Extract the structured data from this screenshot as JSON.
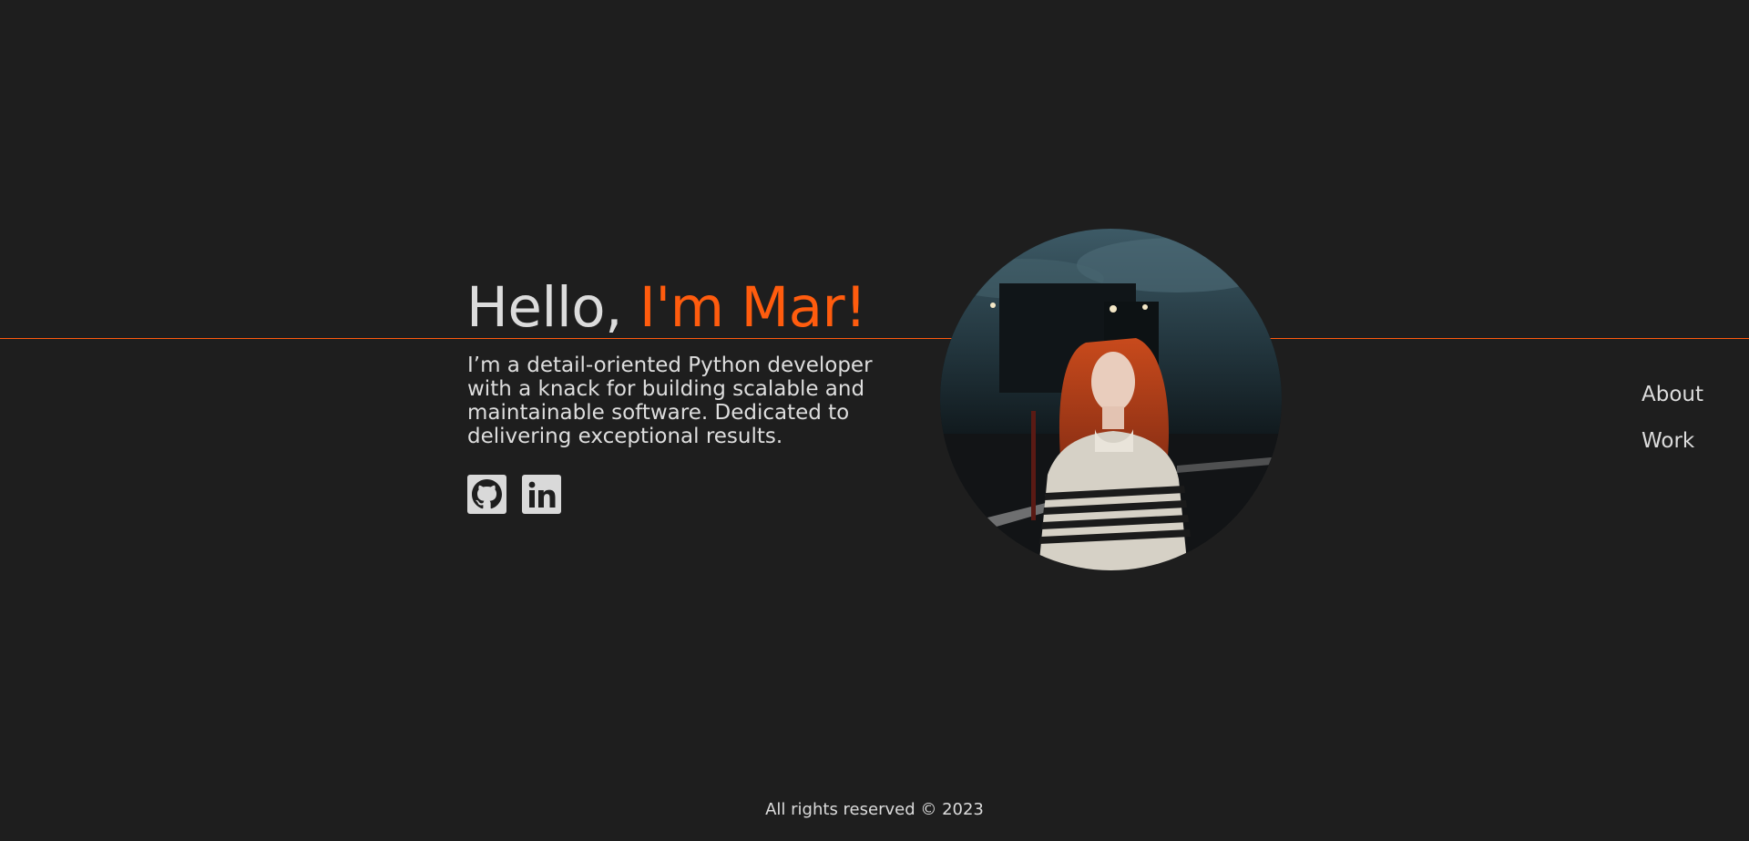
{
  "hero": {
    "greeting": "Hello, ",
    "name": "I'm Mar!",
    "bio": "I’m a detail-oriented Python developer with a knack for building scalable and maintainable software. Dedicated to delivering exceptional results."
  },
  "socials": [
    {
      "icon": "github-icon"
    },
    {
      "icon": "linkedin-icon"
    }
  ],
  "portrait": {
    "description_icon": "profile-photo"
  },
  "nav": {
    "items": [
      {
        "label": "About"
      },
      {
        "label": "Work"
      }
    ]
  },
  "footer": {
    "text": "All rights reserved © 2023"
  },
  "colors": {
    "background": "#1e1e1e",
    "accent": "#ff5c0e",
    "text": "#dcdcdc"
  }
}
